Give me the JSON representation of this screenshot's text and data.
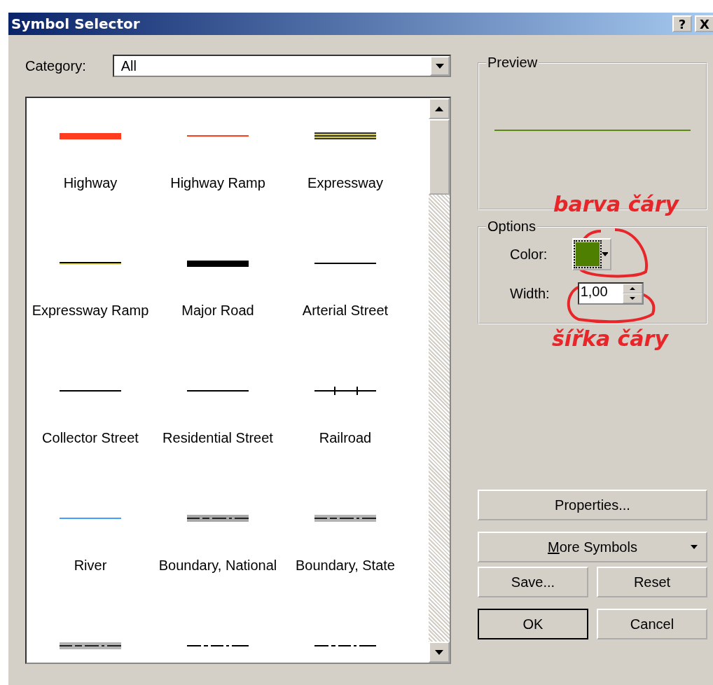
{
  "window": {
    "title": "Symbol Selector",
    "buttons": [
      {
        "kind": "help",
        "label": "?"
      },
      {
        "kind": "close",
        "label": "X"
      }
    ]
  },
  "category": {
    "label": "Category:",
    "value": "All"
  },
  "symbols": [
    {
      "label": "Highway",
      "kind": "thick",
      "color": "#ff3c1e"
    },
    {
      "label": "Highway Ramp",
      "kind": "thin",
      "color": "#ff3c1e"
    },
    {
      "label": "Expressway",
      "kind": "triple",
      "color": "#d8d040"
    },
    {
      "label": "Expressway Ramp",
      "kind": "cased",
      "color": "#e8e060"
    },
    {
      "label": "Major Road",
      "kind": "thick",
      "color": "#000000"
    },
    {
      "label": "Arterial Street",
      "kind": "thin",
      "color": "#000000"
    },
    {
      "label": "Collector Street",
      "kind": "thin",
      "color": "#000000"
    },
    {
      "label": "Residential Street",
      "kind": "thin",
      "color": "#000000"
    },
    {
      "label": "Railroad",
      "kind": "rail",
      "color": "#000000"
    },
    {
      "label": "River",
      "kind": "thin",
      "color": "#3fa0ff"
    },
    {
      "label": "Boundary, National",
      "kind": "halo",
      "color": "#a8a8a8"
    },
    {
      "label": "Boundary, State",
      "kind": "halo",
      "color": "#b4b4b4"
    },
    {
      "kind": "halo",
      "color": "#b4b4b4"
    },
    {
      "kind": "dashdot",
      "color": "#000000"
    },
    {
      "kind": "dashdot",
      "color": "#000000"
    }
  ],
  "preview": {
    "label": "Preview"
  },
  "options": {
    "label": "Options",
    "color_label": "Color:",
    "color": "#4f7f00",
    "width_label": "Width:",
    "width_value": "1,00"
  },
  "annotations": [
    {
      "text": "barva čáry"
    },
    {
      "text": "šířka čáry"
    }
  ],
  "buttons": [
    {
      "label": "Properties...",
      "kind": "wide"
    },
    {
      "label": "More Symbols",
      "kind": "menu",
      "mnemonic_first": true
    },
    {
      "label": "Save...",
      "kind": "half"
    },
    {
      "label": "Reset",
      "kind": "half"
    },
    {
      "label": "OK",
      "kind": "default"
    },
    {
      "label": "Cancel",
      "kind": "half"
    }
  ]
}
